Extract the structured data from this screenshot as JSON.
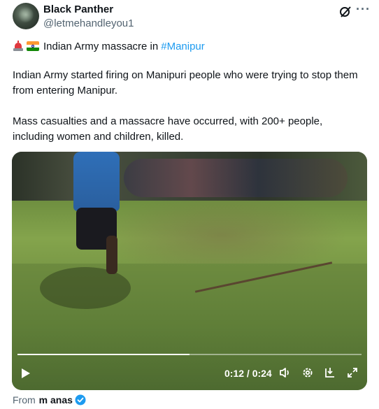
{
  "author": {
    "display_name": "Black Panther",
    "handle": "@letmehandleyou1"
  },
  "header_icons": [
    "grok-icon",
    "more-icon"
  ],
  "post": {
    "title_text": "Indian Army massacre in",
    "hashtag": "#Manipur",
    "emojis": [
      "police-siren-icon",
      "india-flag-icon"
    ],
    "paragraph1": "Indian Army started firing on Manipuri people who were trying to stop them from entering Manipur.",
    "paragraph2": "Mass casualties and a massacre have occurred, with 200+ people, including women and children, killed."
  },
  "video": {
    "time": "0:12 / 0:24",
    "progress": 0.5,
    "controls": [
      "play-icon",
      "volume-icon",
      "settings-icon",
      "download-icon",
      "fullscreen-icon"
    ]
  },
  "from": {
    "label": "From",
    "name": "m anas"
  },
  "colors": {
    "accent": "#1d9bf0",
    "text": "#0f1419",
    "muted": "#536471"
  }
}
